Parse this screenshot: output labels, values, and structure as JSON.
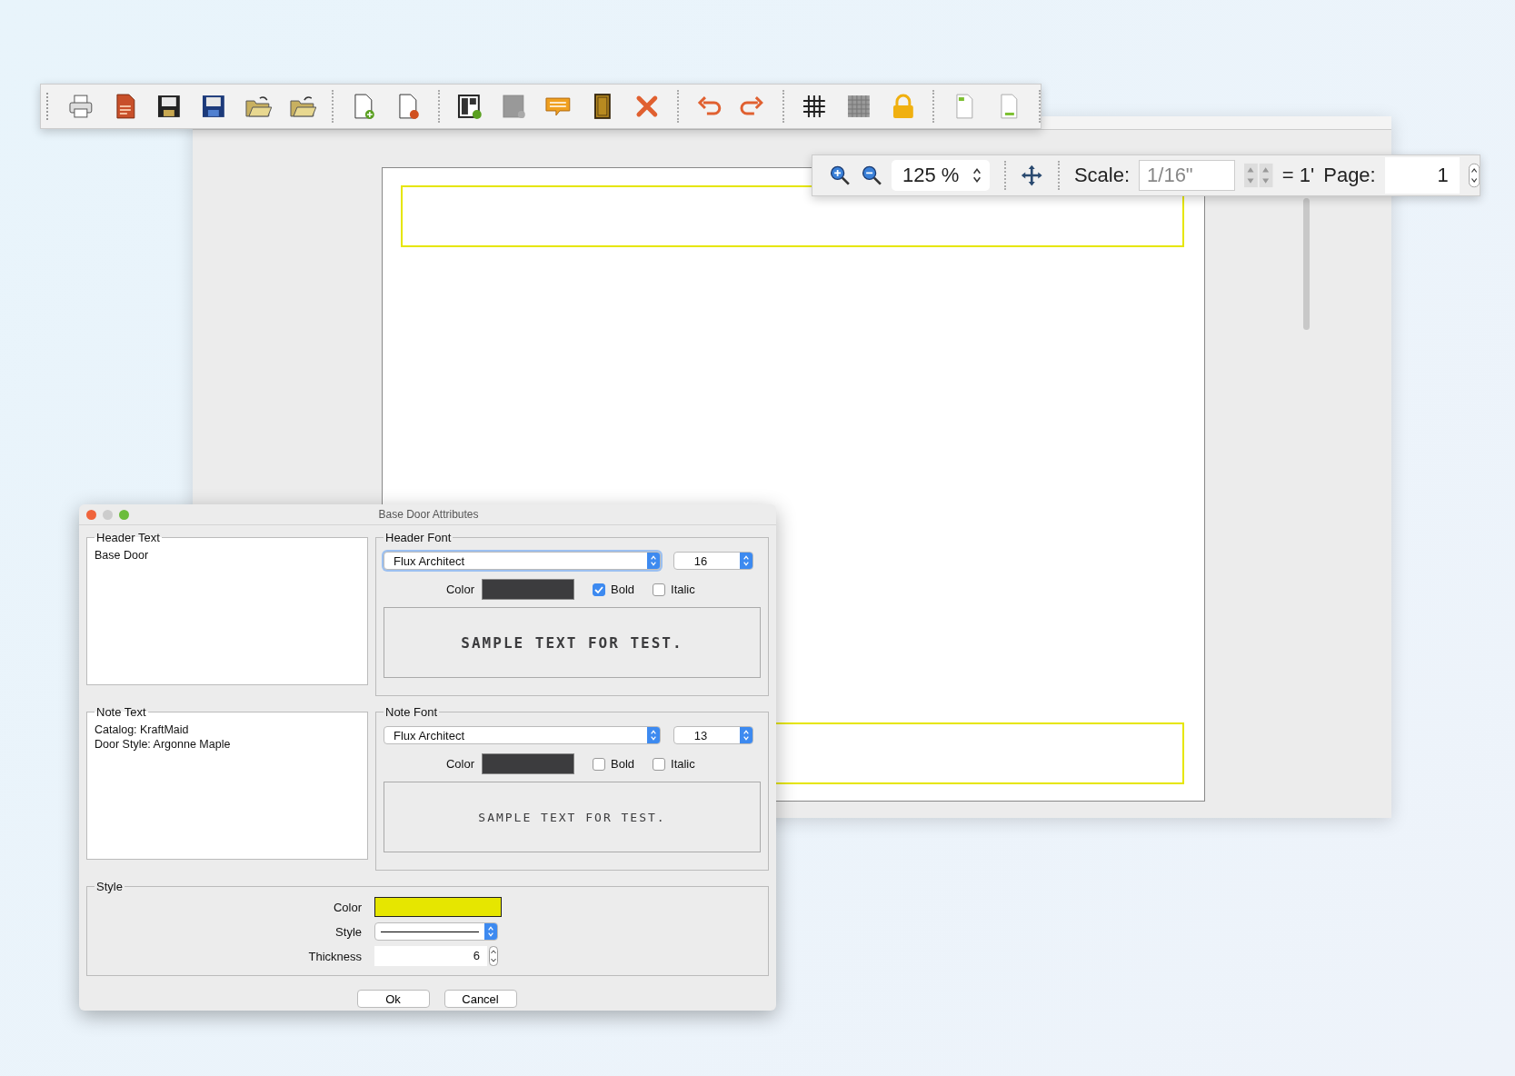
{
  "zoom_bar": {
    "zoom": "125 %",
    "scale_label": "Scale:",
    "scale_value": "1/16\"",
    "equals": "= 1'",
    "page_label": "Page:",
    "page_value": "1"
  },
  "dialog": {
    "title": "Base Door Attributes",
    "header_text": {
      "legend": "Header Text",
      "lines": [
        "Base Door"
      ]
    },
    "header_font": {
      "legend": "Header Font",
      "font": "Flux Architect",
      "size": "16",
      "color_label": "Color",
      "color": "#3c3c3e",
      "bold": {
        "label": "Bold",
        "checked": true
      },
      "italic": {
        "label": "Italic",
        "checked": false
      },
      "sample": "SAMPLE TEXT FOR TEST."
    },
    "note_text": {
      "legend": "Note Text",
      "lines": [
        "Catalog: KraftMaid",
        "Door Style: Argonne Maple"
      ]
    },
    "note_font": {
      "legend": "Note Font",
      "font": "Flux Architect",
      "size": "13",
      "color_label": "Color",
      "color": "#3c3c3e",
      "bold": {
        "label": "Bold",
        "checked": false
      },
      "italic": {
        "label": "Italic",
        "checked": false
      },
      "sample": "SAMPLE TEXT FOR TEST."
    },
    "style": {
      "legend": "Style",
      "color_label": "Color",
      "color": "#e6e600",
      "style_label": "Style",
      "thickness_label": "Thickness",
      "thickness": "6"
    },
    "buttons": [
      "Ok",
      "Cancel"
    ]
  }
}
